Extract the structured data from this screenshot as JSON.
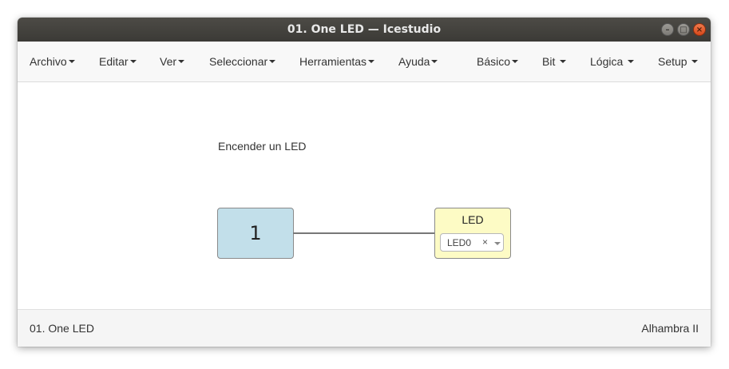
{
  "window": {
    "title": "01. One LED — Icestudio",
    "controls": {
      "minimize_icon": "–",
      "maximize_icon": "□",
      "close_icon": "×"
    }
  },
  "menubar": {
    "items": [
      {
        "label": "Archivo"
      },
      {
        "label": "Editar"
      },
      {
        "label": "Ver"
      },
      {
        "label": "Seleccionar"
      },
      {
        "label": "Herramientas"
      },
      {
        "label": "Ayuda"
      },
      {
        "label": "Básico"
      },
      {
        "label": "Bit"
      },
      {
        "label": "Lógica"
      },
      {
        "label": "Setup"
      }
    ]
  },
  "canvas": {
    "comment": "Encender un LED",
    "constant_block": {
      "value": "1",
      "color": "#c2dfea"
    },
    "led_block": {
      "title": "LED",
      "pin_value": "LED0",
      "clear_icon": "×",
      "color": "#fdfbc5"
    }
  },
  "footer": {
    "project_name": "01. One LED",
    "board_name": "Alhambra II"
  }
}
